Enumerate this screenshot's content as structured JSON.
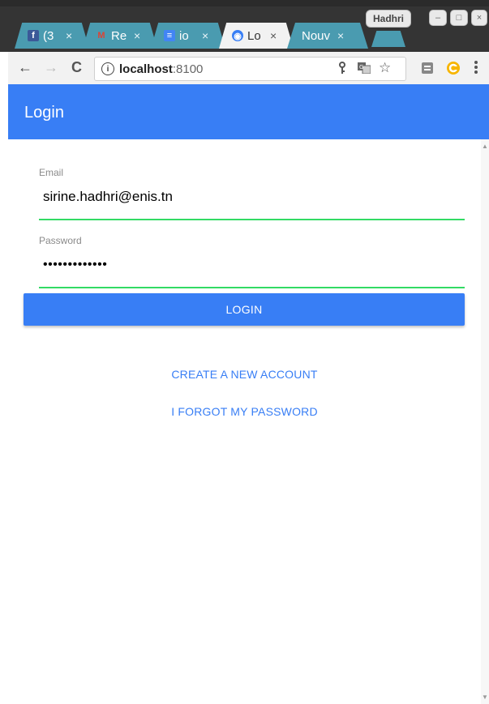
{
  "browser": {
    "tabs": [
      {
        "title": "(3",
        "icon": "facebook-icon",
        "icon_glyph": "f",
        "icon_color": "#3b5998"
      },
      {
        "title": "Re",
        "icon": "gmail-icon",
        "icon_glyph": "M",
        "icon_color": "#db4437"
      },
      {
        "title": "io",
        "icon": "docs-icon",
        "icon_glyph": "≡",
        "icon_color": "#4285f4"
      },
      {
        "title": "Lo",
        "icon": "ionic-icon",
        "icon_glyph": "◉",
        "icon_color": "#387ef5"
      },
      {
        "title": "Nouv",
        "icon": "",
        "icon_glyph": "",
        "icon_color": ""
      }
    ],
    "tab_close_glyph": "×",
    "profile_name": "Hadhri",
    "window_buttons": {
      "minimize": "–",
      "maximize": "□",
      "close": "×"
    },
    "nav": {
      "back": "←",
      "forward": "→",
      "reload": "C"
    },
    "url": {
      "info": "i",
      "host": "localhost",
      "port": ":8100"
    },
    "omnibox_icons": {
      "key": "🔑",
      "translate": "⊞",
      "star": "☆"
    }
  },
  "app": {
    "title": "Login",
    "email": {
      "label": "Email",
      "value": "sirine.hadhri@enis.tn"
    },
    "password": {
      "label": "Password",
      "value": "•••••••••••••"
    },
    "login_label": "LOGIN",
    "create_account_label": "CREATE A NEW ACCOUNT",
    "forgot_password_label": "I FORGOT MY PASSWORD"
  },
  "colors": {
    "primary": "#387ef5",
    "input_underline": "#32db64",
    "tab_inactive": "#4a9bb0"
  }
}
